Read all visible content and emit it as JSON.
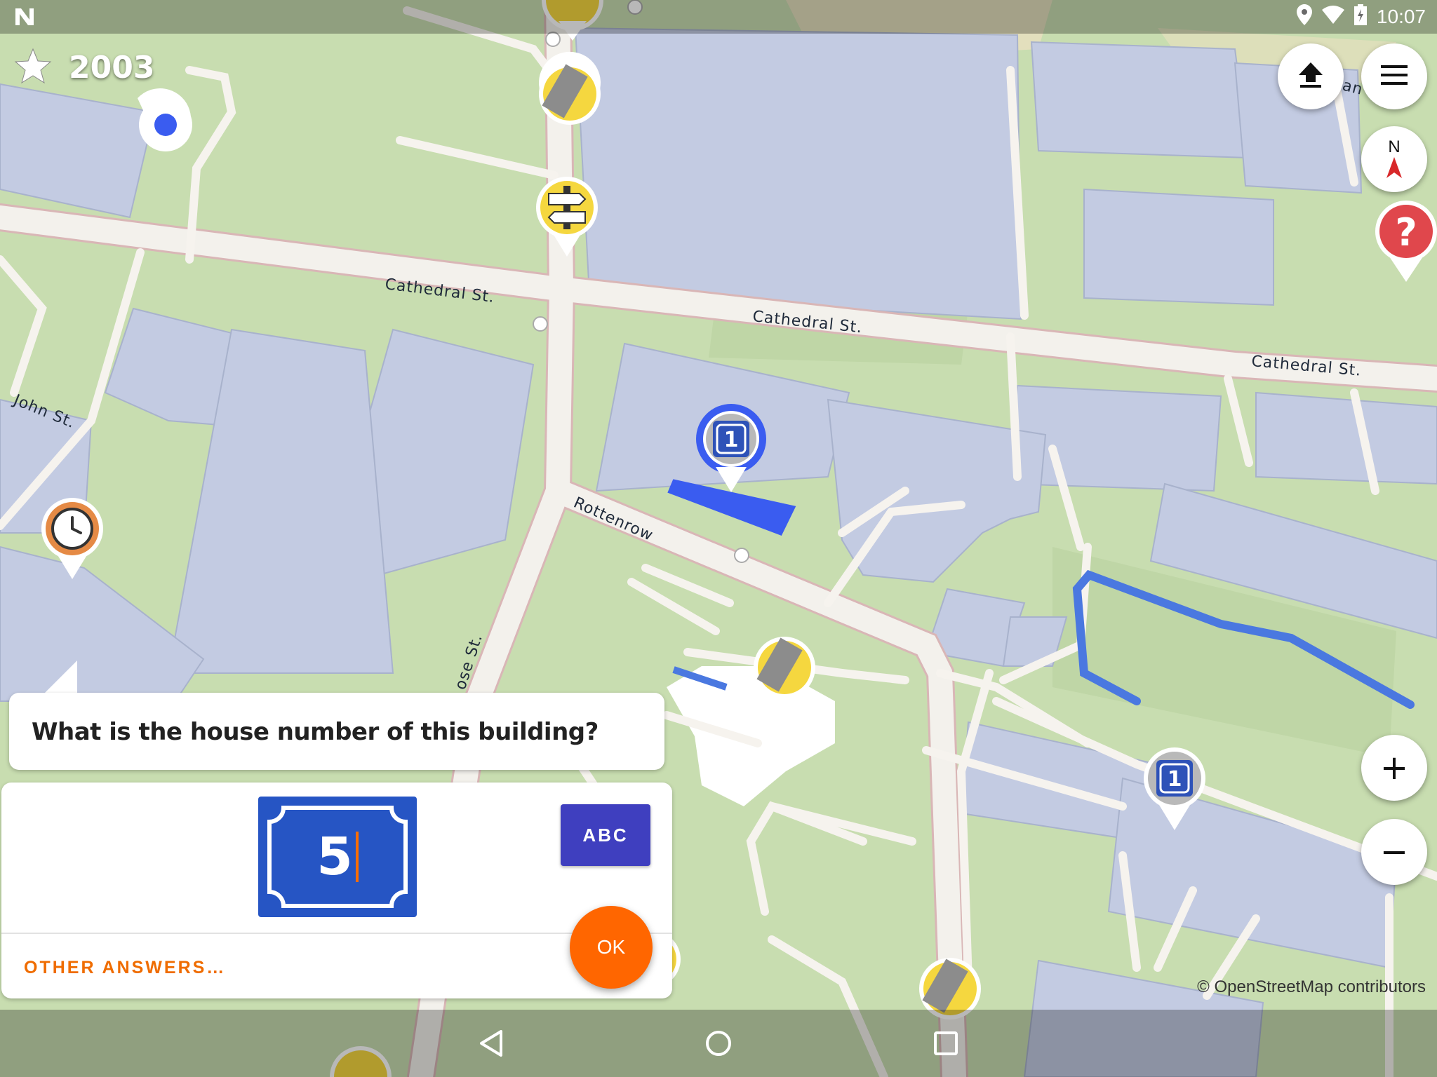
{
  "status_bar": {
    "time": "10:07"
  },
  "score": {
    "value": "2003"
  },
  "streets": {
    "cathedral_1": "Cathedral St.",
    "cathedral_2": "Cathedral St.",
    "cathedral_3": "Cathedral St.",
    "john": "John St.",
    "rottenrow": "Rottenrow",
    "rose": "ose St.",
    "partial_top_right": "an"
  },
  "quest": {
    "question": "What is the house number of this building?",
    "answer_value": "5",
    "abc_label": "ABC",
    "other_answers_label": "OTHER ANSWERS…",
    "ok_label": "OK"
  },
  "compass": {
    "label": "N"
  },
  "map_controls": {
    "zoom_in": "+",
    "zoom_out": "−"
  },
  "attribution": "© OpenStreetMap contributors",
  "colors": {
    "accent_orange": "#ff6600",
    "sign_blue": "#2655c4",
    "abc_button": "#3f3fbf",
    "building": "#c3cbe2",
    "grass": "#c8ddb0",
    "road": "#f2efe8",
    "quest_red": "#e0474c",
    "quest_yellow": "#f5d73f"
  }
}
